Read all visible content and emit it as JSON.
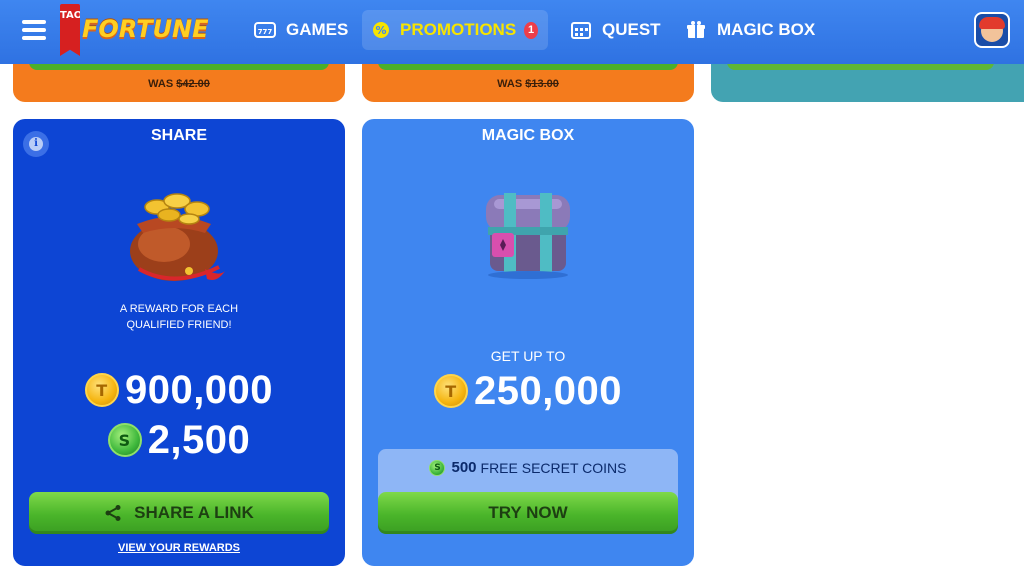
{
  "header": {
    "logo_letters": "TAO",
    "logo_text": "FORTUNE",
    "nav": [
      {
        "label": "GAMES",
        "icon": "slot-machine-icon"
      },
      {
        "label": "PROMOTIONS",
        "icon": "percent-icon",
        "badge": "1"
      },
      {
        "label": "QUEST",
        "icon": "calendar-icon"
      },
      {
        "label": "MAGIC BOX",
        "icon": "gift-box-icon"
      }
    ]
  },
  "top_cards": [
    {
      "was_label": "WAS",
      "was_price": "$42.00"
    },
    {
      "was_label": "WAS",
      "was_price": "$13.00"
    }
  ],
  "share_card": {
    "title": "SHARE",
    "description_line1": "A REWARD FOR EACH",
    "description_line2": "QUALIFIED FRIEND!",
    "gold_amount": "900,000",
    "sweeps_amount": "2,500",
    "button_label": "SHARE A LINK",
    "link_label": "VIEW YOUR REWARDS"
  },
  "magic_card": {
    "title": "MAGIC BOX",
    "get_up_to": "GET UP TO",
    "gold_amount": "250,000",
    "bonus_amount": "500",
    "bonus_label": "FREE SECRET COINS",
    "button_label": "TRY NOW"
  },
  "colors": {
    "nav_blue": "#3f86f0",
    "share_card_blue": "#0d45d4",
    "magic_card_blue": "#3f86f0",
    "promo_orange": "#f47b1d",
    "teal": "#43a3b2",
    "cta_green": "#4ab52a",
    "active_nav_text": "#f7e400"
  }
}
